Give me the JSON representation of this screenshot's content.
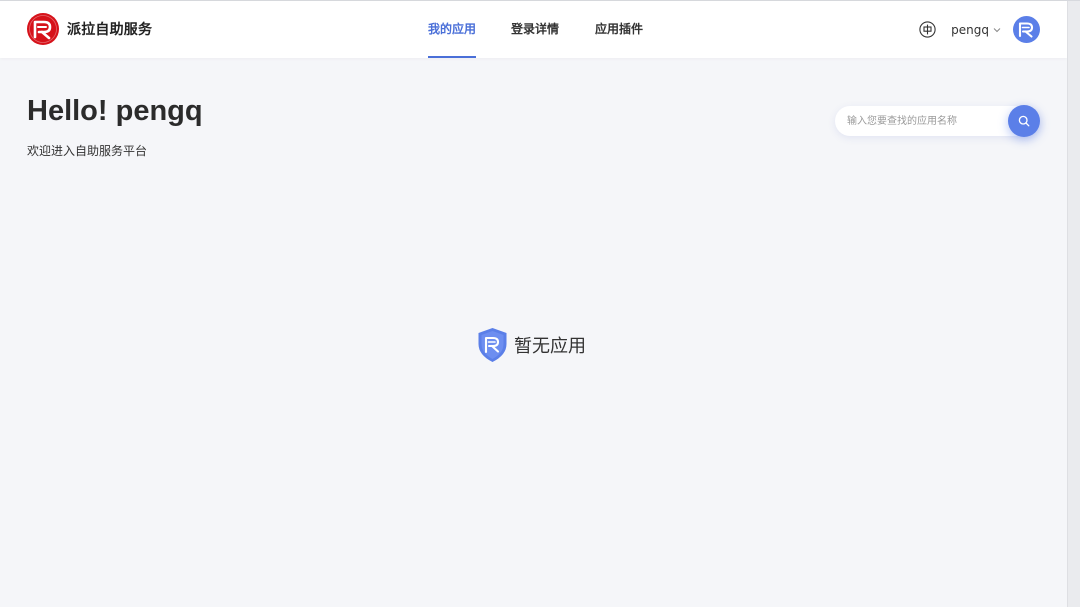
{
  "header": {
    "brand_name": "派拉自助服务",
    "tabs": [
      {
        "label": "我的应用",
        "active": true
      },
      {
        "label": "登录详情",
        "active": false
      },
      {
        "label": "应用插件",
        "active": false
      }
    ],
    "language_icon": "globe-icon",
    "user_name": "pengq",
    "user_menu_icon": "chevron-down-icon"
  },
  "greeting": {
    "title": "Hello! pengq",
    "subtitle": "欢迎进入自助服务平台"
  },
  "search": {
    "placeholder": "输入您要查找的应用名称",
    "value": "",
    "icon": "search-icon"
  },
  "empty_state": {
    "icon": "shield-logo-icon",
    "text": "暂无应用"
  },
  "colors": {
    "accent": "#4a6fd8",
    "search_button": "#5b7fe8",
    "brand_red": "#d6121a",
    "background": "#f5f6f9"
  }
}
